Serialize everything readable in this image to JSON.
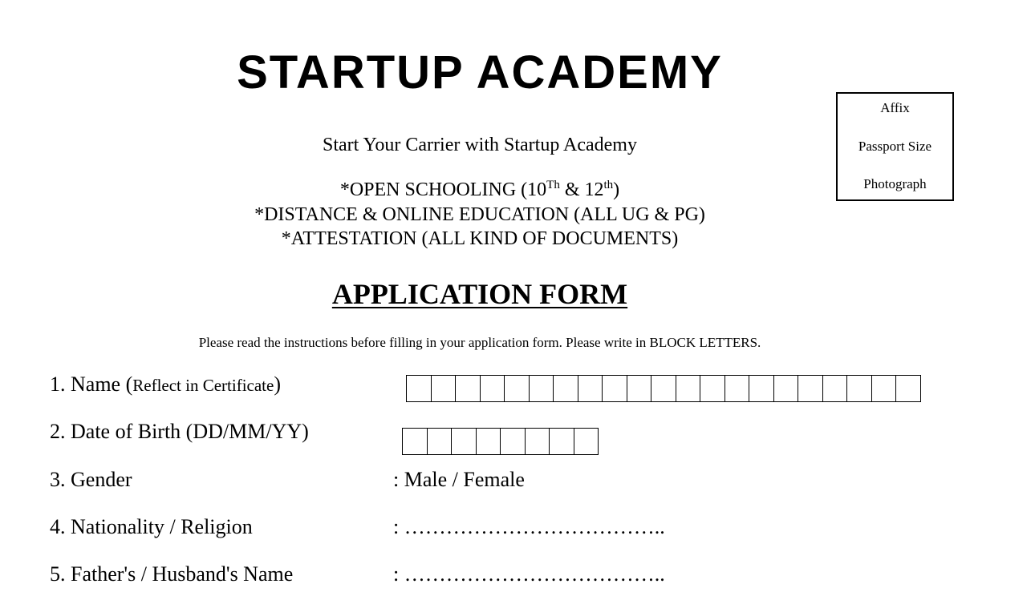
{
  "header": {
    "title": "STARTUP ACADEMY",
    "tagline": "Start Your Carrier with Startup Academy",
    "services": {
      "open_schooling": {
        "prefix": "*OPEN SCHOOLING (10",
        "sup1": "Th",
        "mid": " & 12",
        "sup2": "th",
        "suffix": ")"
      },
      "distance": "*DISTANCE & ONLINE EDUCATION (ALL UG & PG)",
      "attestation": "*ATTESTATION (ALL KIND OF DOCUMENTS)"
    }
  },
  "photo_box": {
    "line1": "Affix",
    "line2": "Passport Size",
    "line3": "Photograph"
  },
  "form": {
    "heading": "APPLICATION FORM",
    "instructions": "Please read the instructions before filling in your application form. Please write in BLOCK LETTERS.",
    "fields": {
      "name": {
        "label": "1. Name (",
        "note": "Reflect in Certificate",
        "close": ")",
        "box_count": 21
      },
      "dob": {
        "label": "2. Date of Birth (DD/MM/YY)",
        "box_count": 8
      },
      "gender": {
        "label": "3. Gender",
        "value": ": Male / Female"
      },
      "nationality": {
        "label": "4. Nationality / Religion",
        "value": ": ……………………………….."
      },
      "father": {
        "label": "5. Father's / Husband's Name",
        "value": ": ……………………………….."
      }
    }
  }
}
